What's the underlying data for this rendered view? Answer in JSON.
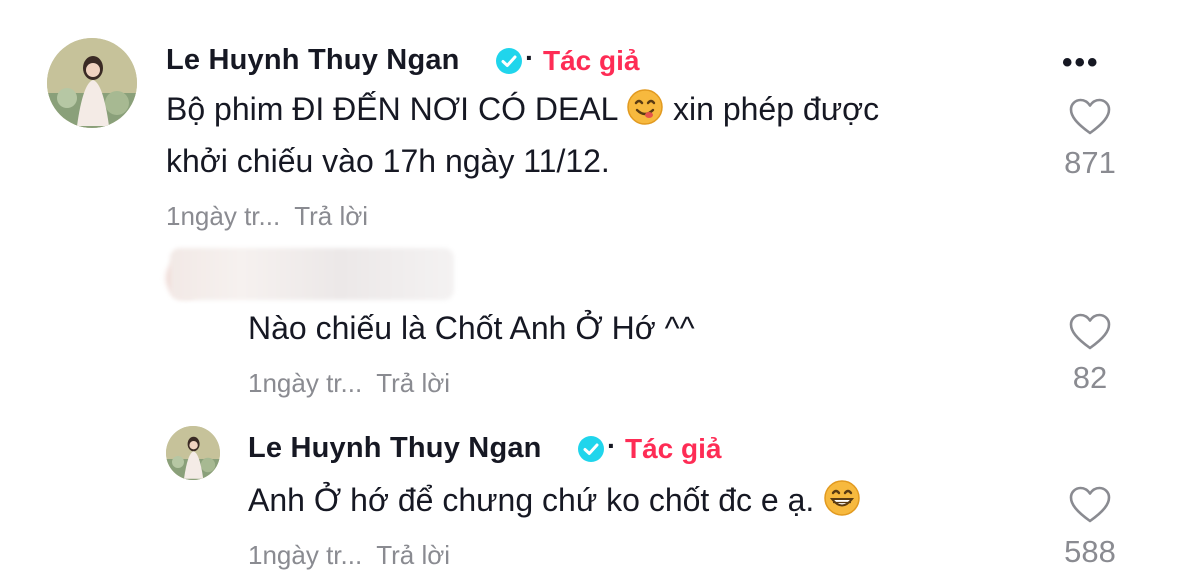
{
  "comments": [
    {
      "username": "Le Huynh Thuy Ngan",
      "author_badge": "Tác giả",
      "text_line1": "Bộ phim ĐI ĐẾN NƠI CÓ DEAL",
      "text_line1_after_emoji": "xin phép được",
      "text_line2": "khởi chiếu vào 17h ngày 11/12.",
      "emoji": "yum-face",
      "time": "1ngày tr...",
      "reply_label": "Trả lời",
      "likes": "871",
      "more_label": "•••"
    },
    {
      "username": "",
      "text": "Nào chiếu là Chốt Anh Ở Hớ ^^",
      "time": "1ngày tr...",
      "reply_label": "Trả lời",
      "likes": "82"
    },
    {
      "username": "Le Huynh Thuy Ngan",
      "author_badge": "Tác giả",
      "text": "Anh Ở hớ để chưng chứ ko chốt đc e ạ.",
      "emoji": "grinning-face",
      "time": "1ngày tr...",
      "reply_label": "Trả lời",
      "likes": "588"
    }
  ],
  "colors": {
    "author_red": "#fe2c55",
    "verified_blue": "#20d5ec",
    "meta_gray": "#8a8b91"
  }
}
